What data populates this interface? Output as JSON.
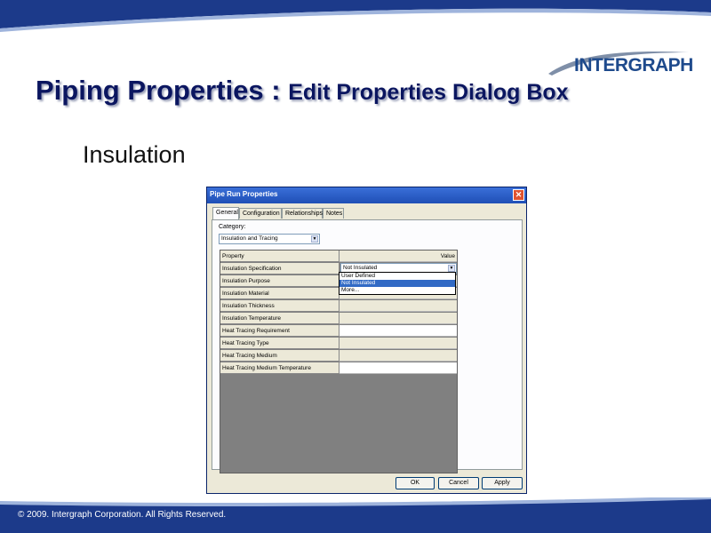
{
  "slide": {
    "title_main": "Piping Properties : ",
    "title_sub": "Edit Properties Dialog Box",
    "subheading": "Insulation",
    "logo_text": "INTERGRAPH",
    "copyright": "© 2009. Intergraph Corporation. All Rights Reserved.",
    "colors": {
      "band": "#1c3a8a",
      "title": "#0b1660"
    }
  },
  "dialog": {
    "title": "Pipe Run Properties",
    "close_glyph": "✕",
    "tabs": [
      {
        "label": "General"
      },
      {
        "label": "Configuration"
      },
      {
        "label": "Relationships"
      },
      {
        "label": "Notes"
      }
    ],
    "category": {
      "label": "Category:",
      "value": "Insulation and Tracing"
    },
    "grid": {
      "header": {
        "property": "Property",
        "value": "Value"
      },
      "rows": [
        {
          "property": "Insulation Specification",
          "value": "Not Insulated"
        },
        {
          "property": "Insulation Purpose",
          "value": ""
        },
        {
          "property": "Insulation Material",
          "value": ""
        },
        {
          "property": "Insulation Thickness",
          "value": ""
        },
        {
          "property": "Insulation Temperature",
          "value": ""
        },
        {
          "property": "Heat Tracing Requirement",
          "value": ""
        },
        {
          "property": "Heat Tracing Type",
          "value": ""
        },
        {
          "property": "Heat Tracing Medium",
          "value": ""
        },
        {
          "property": "Heat Tracing Medium Temperature",
          "value": ""
        }
      ]
    },
    "dropdown_options": [
      {
        "label": "User Defined"
      },
      {
        "label": "Not Insulated"
      },
      {
        "label": "More..."
      }
    ],
    "buttons": {
      "ok": "OK",
      "cancel": "Cancel",
      "apply": "Apply"
    },
    "arrow_glyph": "▼"
  }
}
